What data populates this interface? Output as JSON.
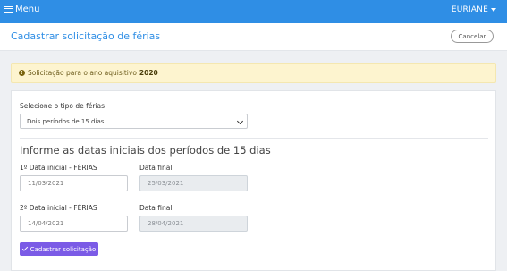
{
  "topbar": {
    "menu_label": "Menu",
    "user_name": "EURIANE"
  },
  "header": {
    "title": "Cadastrar solicitação de férias",
    "cancel_label": "Cancelar"
  },
  "alert": {
    "text": "Solicitação para o ano aquisitivo",
    "year": "2020"
  },
  "form": {
    "type_label": "Selecione o tipo de férias",
    "type_value": "Dois períodos de 15 dias",
    "section_title": "Informe as datas iniciais dos períodos de 15 dias",
    "period1": {
      "start_label": "1º Data inicial - FÉRIAS",
      "start_value": "11/03/2021",
      "end_label": "Data final",
      "end_value": "25/03/2021"
    },
    "period2": {
      "start_label": "2º Data inicial - FÉRIAS",
      "start_value": "14/04/2021",
      "end_label": "Data final",
      "end_value": "28/04/2021"
    },
    "submit_label": "Cadastrar solicitação"
  },
  "colors": {
    "topbar": "#2f8ee5",
    "alert_bg": "#fdf4cf",
    "primary_button": "#7b5be6"
  }
}
